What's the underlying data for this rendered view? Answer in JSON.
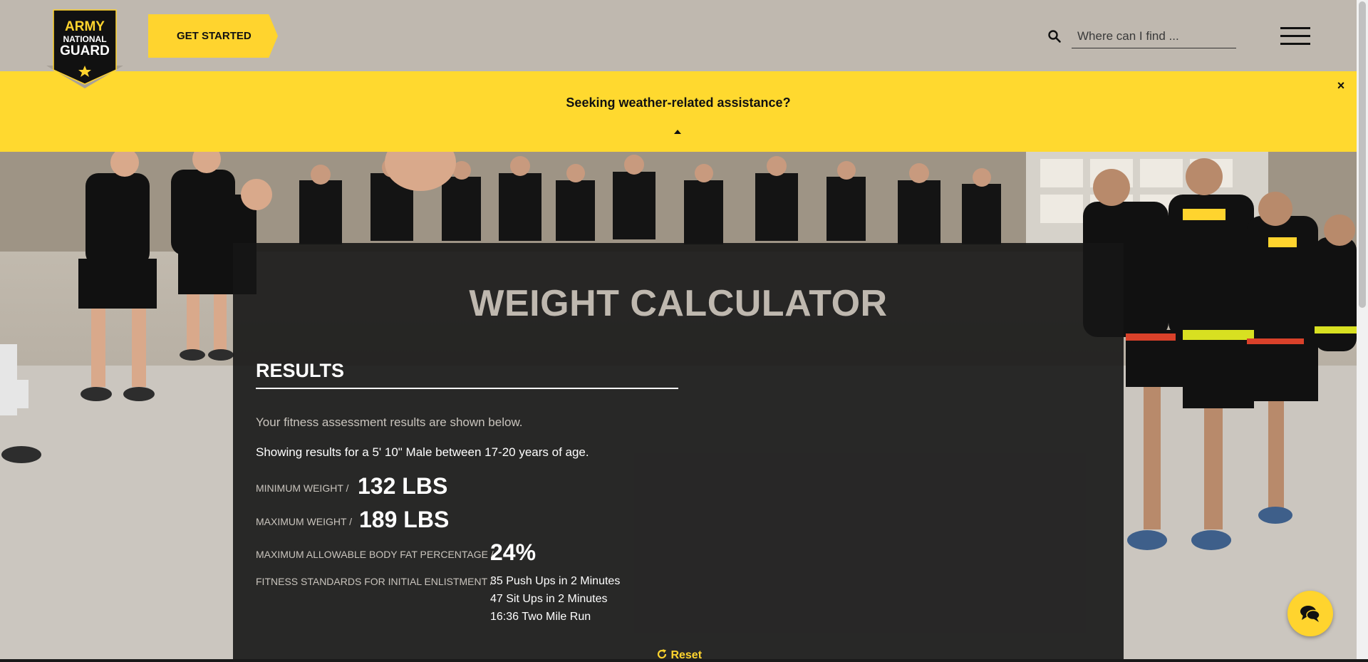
{
  "header": {
    "logo": {
      "line1": "ARMY",
      "line2": "NATIONAL",
      "line3": "GUARD"
    },
    "cta_label": "GET STARTED",
    "search_placeholder": "Where can I find ..."
  },
  "alert": {
    "message": "Seeking weather-related assistance?",
    "close_symbol": "×"
  },
  "calculator": {
    "title": "WEIGHT CALCULATOR",
    "results_heading": "RESULTS",
    "intro": "Your fitness assessment results are shown below.",
    "summary": "Showing results for a 5' 10\" Male between 17-20 years of age.",
    "min_weight_label": "MINIMUM WEIGHT /",
    "min_weight_value": "132 LBS",
    "max_weight_label": "MAXIMUM WEIGHT /",
    "max_weight_value": "189 LBS",
    "body_fat_label": "MAXIMUM ALLOWABLE BODY FAT PERCENTAGE /",
    "body_fat_value": "24%",
    "fitness_label": "FITNESS STANDARDS FOR INITIAL ENLISTMENT /",
    "fitness_standards": [
      "35 Push Ups in 2 Minutes",
      "47 Sit Ups in 2 Minutes",
      "16:36 Two Mile Run"
    ],
    "reset_label": "Reset"
  },
  "colors": {
    "header_bg": "#bfb8af",
    "accent_yellow": "#ffd42e",
    "alert_bg": "#ffd92f",
    "panel_bg": "#161616"
  },
  "icons": [
    "army-guard-logo",
    "search-icon",
    "hamburger-menu-icon",
    "close-icon",
    "caret-up-icon",
    "reset-icon",
    "chat-icon"
  ]
}
